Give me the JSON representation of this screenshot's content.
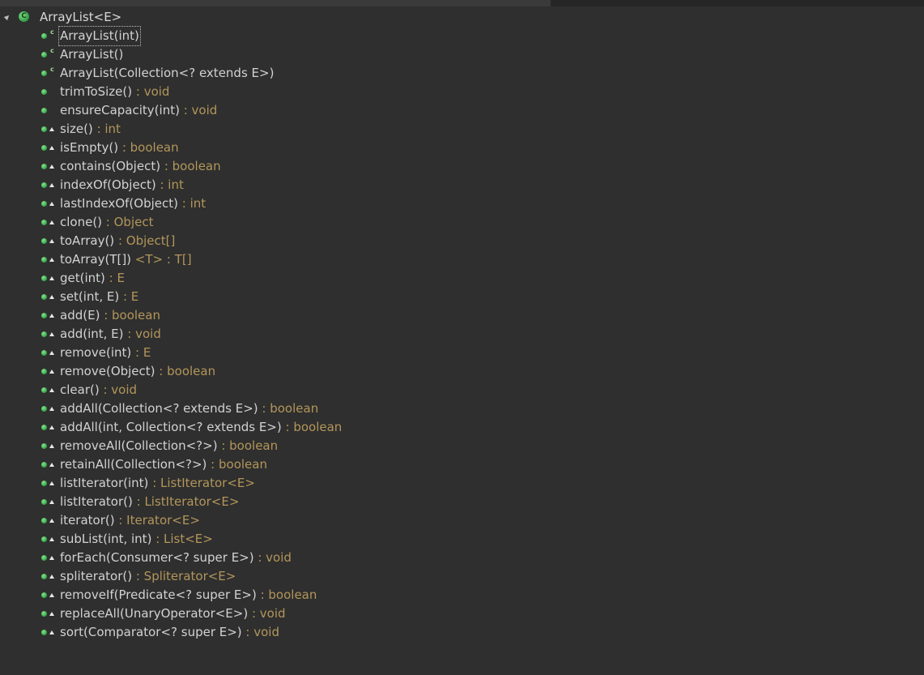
{
  "root": {
    "label": "ArrayList<E>",
    "icon": "class-icon",
    "icon_glyph": "C"
  },
  "members": [
    {
      "sig": "ArrayList(int)",
      "ret": "",
      "kind": "ctor",
      "selected": true
    },
    {
      "sig": "ArrayList()",
      "ret": "",
      "kind": "ctor"
    },
    {
      "sig": "ArrayList(Collection<? extends E>)",
      "ret": "",
      "kind": "ctor"
    },
    {
      "sig": "trimToSize()",
      "ret": " : void",
      "kind": "method"
    },
    {
      "sig": "ensureCapacity(int)",
      "ret": " : void",
      "kind": "method"
    },
    {
      "sig": "size()",
      "ret": " : int",
      "kind": "override"
    },
    {
      "sig": "isEmpty()",
      "ret": " : boolean",
      "kind": "override"
    },
    {
      "sig": "contains(Object)",
      "ret": " : boolean",
      "kind": "override"
    },
    {
      "sig": "indexOf(Object)",
      "ret": " : int",
      "kind": "override"
    },
    {
      "sig": "lastIndexOf(Object)",
      "ret": " : int",
      "kind": "override"
    },
    {
      "sig": "clone()",
      "ret": " : Object",
      "kind": "override"
    },
    {
      "sig": "toArray()",
      "ret": " : Object[]",
      "kind": "override"
    },
    {
      "sig": "toArray(T[])",
      "ret": " <T> : T[]",
      "kind": "override"
    },
    {
      "sig": "get(int)",
      "ret": " : E",
      "kind": "override"
    },
    {
      "sig": "set(int, E)",
      "ret": " : E",
      "kind": "override"
    },
    {
      "sig": "add(E)",
      "ret": " : boolean",
      "kind": "override"
    },
    {
      "sig": "add(int, E)",
      "ret": " : void",
      "kind": "override"
    },
    {
      "sig": "remove(int)",
      "ret": " : E",
      "kind": "override"
    },
    {
      "sig": "remove(Object)",
      "ret": " : boolean",
      "kind": "override"
    },
    {
      "sig": "clear()",
      "ret": " : void",
      "kind": "override"
    },
    {
      "sig": "addAll(Collection<? extends E>)",
      "ret": " : boolean",
      "kind": "override"
    },
    {
      "sig": "addAll(int, Collection<? extends E>)",
      "ret": " : boolean",
      "kind": "override"
    },
    {
      "sig": "removeAll(Collection<?>)",
      "ret": " : boolean",
      "kind": "override"
    },
    {
      "sig": "retainAll(Collection<?>)",
      "ret": " : boolean",
      "kind": "override"
    },
    {
      "sig": "listIterator(int)",
      "ret": " : ListIterator<E>",
      "kind": "override"
    },
    {
      "sig": "listIterator()",
      "ret": " : ListIterator<E>",
      "kind": "override"
    },
    {
      "sig": "iterator()",
      "ret": " : Iterator<E>",
      "kind": "override"
    },
    {
      "sig": "subList(int, int)",
      "ret": " : List<E>",
      "kind": "override"
    },
    {
      "sig": "forEach(Consumer<? super E>)",
      "ret": " : void",
      "kind": "override"
    },
    {
      "sig": "spliterator()",
      "ret": " : Spliterator<E>",
      "kind": "override"
    },
    {
      "sig": "removeIf(Predicate<? super E>)",
      "ret": " : boolean",
      "kind": "override"
    },
    {
      "sig": "replaceAll(UnaryOperator<E>)",
      "ret": " : void",
      "kind": "override"
    },
    {
      "sig": "sort(Comparator<? super E>)",
      "ret": " : void",
      "kind": "override"
    }
  ],
  "colors": {
    "background": "#2f2f2f",
    "text": "#d2d2d2",
    "return_type": "#b3965a",
    "public_dot": "#35a84a"
  }
}
